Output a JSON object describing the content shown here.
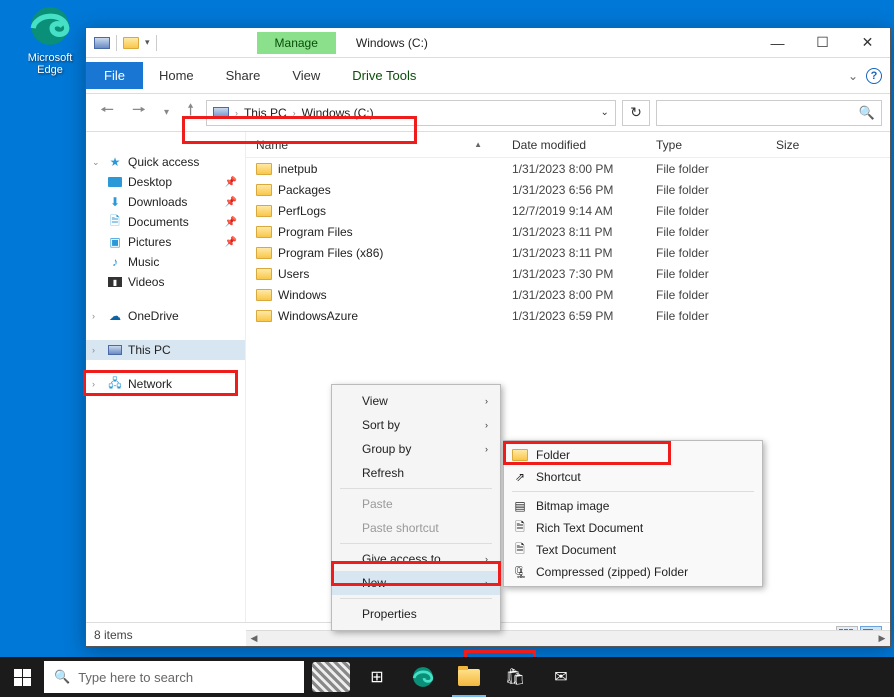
{
  "desktop": {
    "edge_label": "Microsoft Edge"
  },
  "window": {
    "title": "Windows (C:)",
    "contextual_tab": "Manage",
    "contextual_group": "Drive Tools",
    "tabs": {
      "file": "File",
      "home": "Home",
      "share": "Share",
      "view": "View"
    },
    "breadcrumb": {
      "seg1": "This PC",
      "seg2": "Windows (C:)"
    },
    "columns": {
      "name": "Name",
      "date": "Date modified",
      "type": "Type",
      "size": "Size"
    },
    "nav": {
      "quick_access": "Quick access",
      "desktop": "Desktop",
      "downloads": "Downloads",
      "documents": "Documents",
      "pictures": "Pictures",
      "music": "Music",
      "videos": "Videos",
      "onedrive": "OneDrive",
      "thispc": "This PC",
      "network": "Network"
    },
    "folders": [
      {
        "name": "inetpub",
        "date": "1/31/2023 8:00 PM",
        "type": "File folder"
      },
      {
        "name": "Packages",
        "date": "1/31/2023 6:56 PM",
        "type": "File folder"
      },
      {
        "name": "PerfLogs",
        "date": "12/7/2019 9:14 AM",
        "type": "File folder"
      },
      {
        "name": "Program Files",
        "date": "1/31/2023 8:11 PM",
        "type": "File folder"
      },
      {
        "name": "Program Files (x86)",
        "date": "1/31/2023 8:11 PM",
        "type": "File folder"
      },
      {
        "name": "Users",
        "date": "1/31/2023 7:30 PM",
        "type": "File folder"
      },
      {
        "name": "Windows",
        "date": "1/31/2023 8:00 PM",
        "type": "File folder"
      },
      {
        "name": "WindowsAzure",
        "date": "1/31/2023 6:59 PM",
        "type": "File folder"
      }
    ],
    "status": "8 items"
  },
  "context_menu": {
    "view": "View",
    "sortby": "Sort by",
    "groupby": "Group by",
    "refresh": "Refresh",
    "paste": "Paste",
    "paste_shortcut": "Paste shortcut",
    "give_access": "Give access to",
    "new": "New",
    "properties": "Properties"
  },
  "new_submenu": {
    "folder": "Folder",
    "shortcut": "Shortcut",
    "bitmap": "Bitmap image",
    "rtf": "Rich Text Document",
    "txt": "Text Document",
    "zip": "Compressed (zipped) Folder"
  },
  "taskbar": {
    "search_placeholder": "Type here to search"
  }
}
